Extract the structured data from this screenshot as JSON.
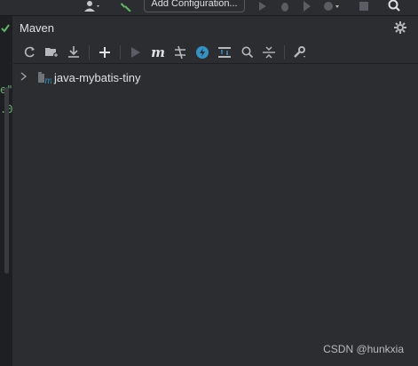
{
  "topbar": {
    "add_configuration": "Add Configuration..."
  },
  "gutter": {
    "fragments": [
      "e\"",
      ".0"
    ]
  },
  "panel": {
    "title": "Maven",
    "toolbar": {
      "icons": [
        "reload-icon",
        "add-folder-icon",
        "download-icon",
        "plus-icon",
        "run-icon",
        "maven-goal-icon",
        "skip-tests-icon",
        "offline-icon",
        "collapse-all-icon",
        "search-icon",
        "expand-icon",
        "settings-wrench-icon"
      ]
    }
  },
  "tree": {
    "items": [
      {
        "label": "java-mybatis-tiny",
        "expanded": false
      }
    ]
  },
  "watermark": "CSDN @hunkxia",
  "colors": {
    "panel_bg": "#2b2d30",
    "accent_blue": "#3592c4",
    "green": "#5fb865"
  }
}
